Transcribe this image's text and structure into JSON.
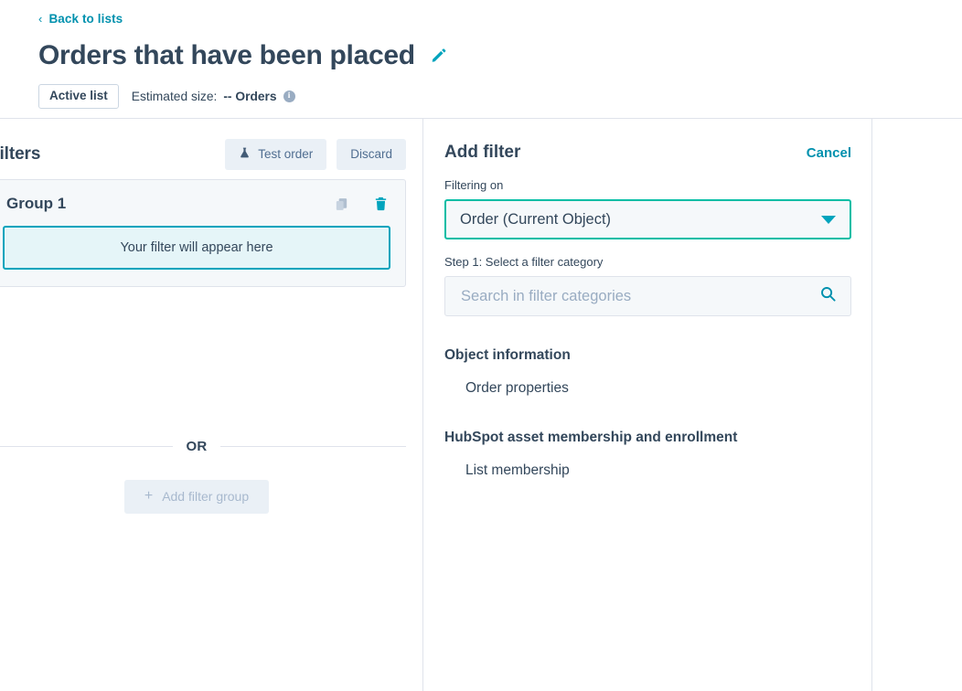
{
  "header": {
    "back_link": "Back to lists",
    "back_chevron": "‹",
    "title": "Orders that have been placed",
    "edit_icon": "pencil-icon",
    "badge": "Active list",
    "estimated_prefix": "Estimated size:",
    "estimated_value": "-- Orders",
    "info_icon": "i"
  },
  "filters_panel": {
    "title": "Filters",
    "test_button": "Test order",
    "test_icon": "flask-icon",
    "discard_button": "Discard",
    "group": {
      "name": "Group 1",
      "duplicate_icon": "copy-icon",
      "delete_icon": "trash-icon",
      "placeholder": "Your filter will appear here"
    },
    "or_label": "OR",
    "add_group_button": "Add filter group",
    "add_group_icon": "plus-icon"
  },
  "add_filter_panel": {
    "title": "Add filter",
    "cancel": "Cancel",
    "filtering_on_label": "Filtering on",
    "filtering_on_value": "Order (Current Object)",
    "dropdown_icon": "chevron-down-icon",
    "step1_label": "Step 1: Select a filter category",
    "search_placeholder": "Search in filter categories",
    "search_value": "",
    "search_icon": "search-icon",
    "sections": [
      {
        "heading": "Object information",
        "items": [
          "Order properties"
        ]
      },
      {
        "heading": "HubSpot asset membership and enrollment",
        "items": [
          "List membership"
        ]
      }
    ]
  },
  "colors": {
    "teal": "#00a4bd",
    "green_teal": "#00bda5",
    "link": "#0091ae",
    "text": "#33475b",
    "border": "#dfe3eb",
    "panel_bg": "#f5f8fa",
    "highlight_bg": "#e5f5f8"
  }
}
